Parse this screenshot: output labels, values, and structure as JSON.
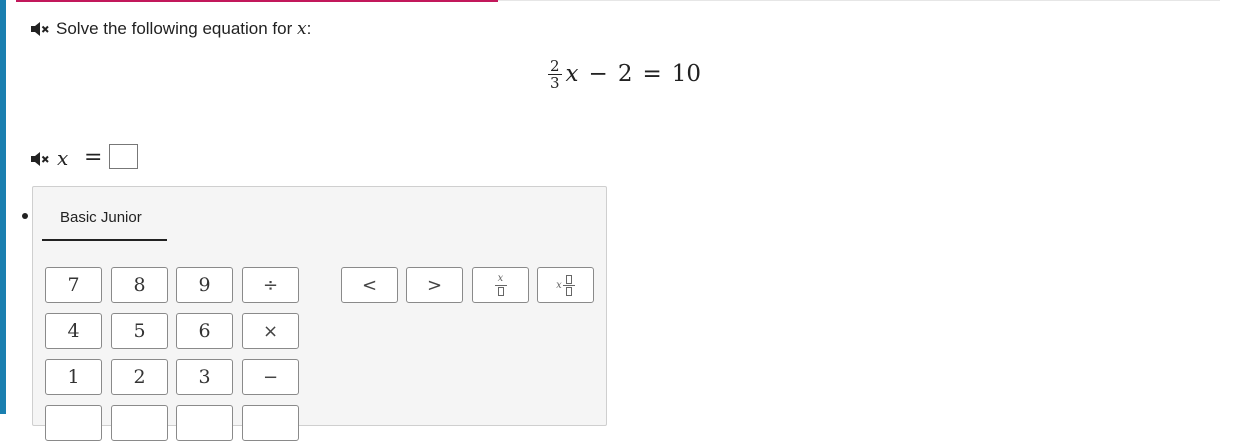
{
  "colors": {
    "accent_bar": "#1a7fb0",
    "progress": "#c2185b"
  },
  "prompt": {
    "text": "Solve the following equation for ",
    "variable": "x",
    "suffix": ":",
    "icon": "speaker-mute-icon"
  },
  "equation": {
    "numerator": "2",
    "denominator": "3",
    "variable": "x",
    "minus": "−",
    "constant": "2",
    "equals": "=",
    "result": "10"
  },
  "answer": {
    "variable": "x",
    "equals": "=",
    "value": "",
    "icon": "speaker-mute-icon"
  },
  "keypad": {
    "tab_label": "Basic Junior",
    "keys": {
      "seven": "7",
      "eight": "8",
      "nine": "9",
      "divide": "÷",
      "four": "4",
      "five": "5",
      "six": "6",
      "multiply": "×",
      "one": "1",
      "two": "2",
      "three": "3",
      "minus": "−",
      "left": "<",
      "right": ">"
    },
    "template_keys": {
      "fraction_var": "x",
      "mixed_var": "x"
    }
  }
}
